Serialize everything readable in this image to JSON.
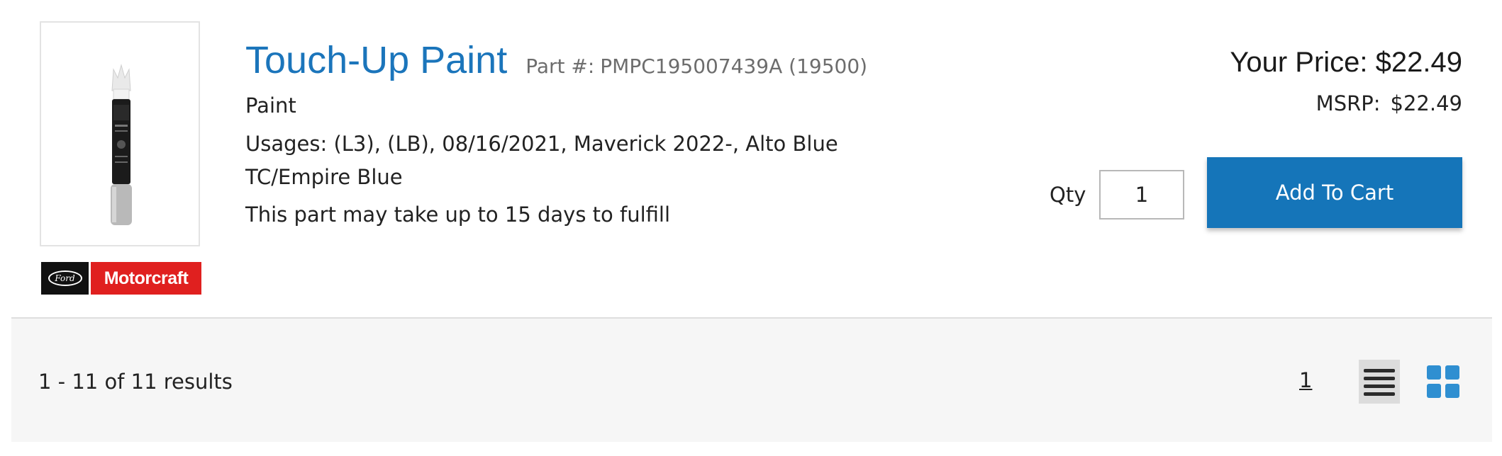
{
  "product": {
    "title": "Touch-Up Paint",
    "part_label": "Part #:",
    "part_number": "PMPC195007439A (19500)",
    "category": "Paint",
    "usages": "Usages: (L3), (LB), 08/16/2021, Maverick 2022-, Alto Blue TC/Empire Blue",
    "fulfillment_note": "This part may take up to 15 days to fulfill",
    "image_icon": "touch-up-paint-pen-icon"
  },
  "brand": {
    "ford_text": "Ford",
    "motorcraft_text": "Motorcraft",
    "colors": {
      "ford_bg": "#111111",
      "motorcraft_bg": "#e0201f"
    }
  },
  "pricing": {
    "your_price": "Your Price: $22.49",
    "msrp_label": "MSRP:",
    "msrp_value": "$22.49"
  },
  "cart": {
    "qty_label": "Qty",
    "qty_value": "1",
    "add_to_cart_label": "Add To Cart",
    "button_color": "#1575b9"
  },
  "results": {
    "count_text": "1 - 11 of 11 results",
    "page_number": "1",
    "view_list_icon": "list-view-icon",
    "view_grid_icon": "grid-view-icon",
    "active_view": "list"
  },
  "colors": {
    "title": "#1b75bb",
    "accent": "#1575b9",
    "grid_icon": "#2f8fd1"
  }
}
